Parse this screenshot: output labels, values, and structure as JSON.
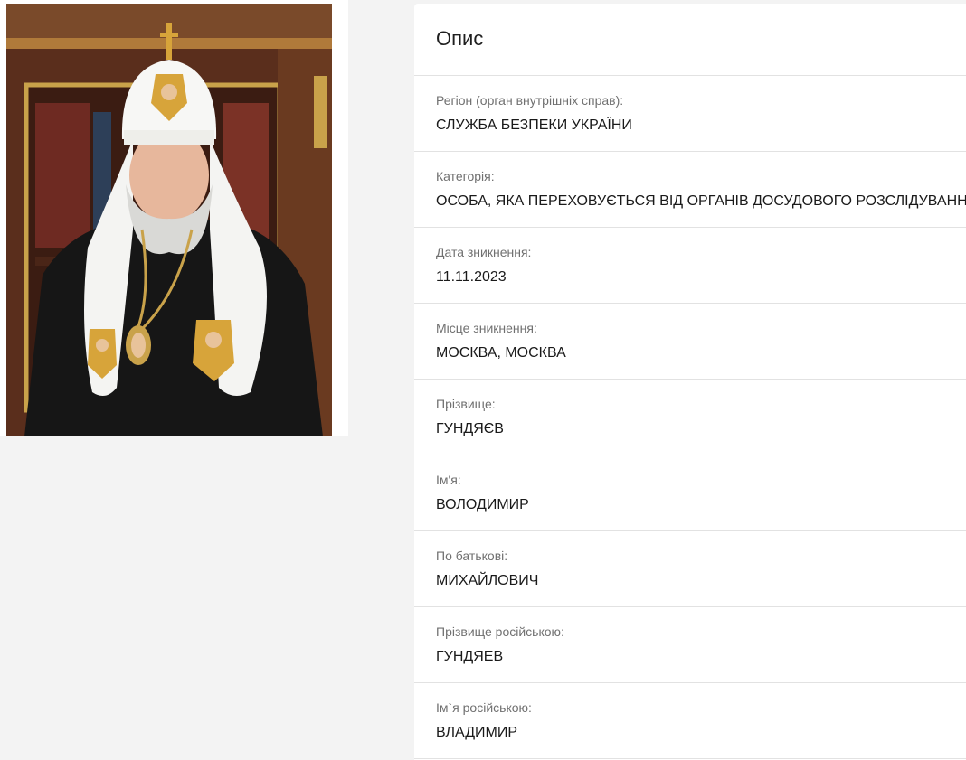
{
  "card": {
    "title": "Опис",
    "rows": [
      {
        "label": "Регіон (орган внутрішніх справ):",
        "value": "СЛУЖБА БЕЗПЕКИ УКРАЇНИ"
      },
      {
        "label": "Категорія:",
        "value": "ОСОБА, ЯКА ПЕРЕХОВУЄТЬСЯ ВІД ОРГАНІВ ДОСУДОВОГО РОЗСЛІДУВАННЯ"
      },
      {
        "label": "Дата зникнення:",
        "value": "11.11.2023"
      },
      {
        "label": "Місце зникнення:",
        "value": "МОСКВА, МОСКВА"
      },
      {
        "label": "Прізвище:",
        "value": "ГУНДЯЄВ"
      },
      {
        "label": "Ім'я:",
        "value": "ВОЛОДИМИР"
      },
      {
        "label": "По батькові:",
        "value": "МИХАЙЛОВИЧ"
      },
      {
        "label": "Прізвище російською:",
        "value": "ГУНДЯЕВ"
      },
      {
        "label": "Ім`я російською:",
        "value": "ВЛАДИМИР"
      }
    ]
  }
}
